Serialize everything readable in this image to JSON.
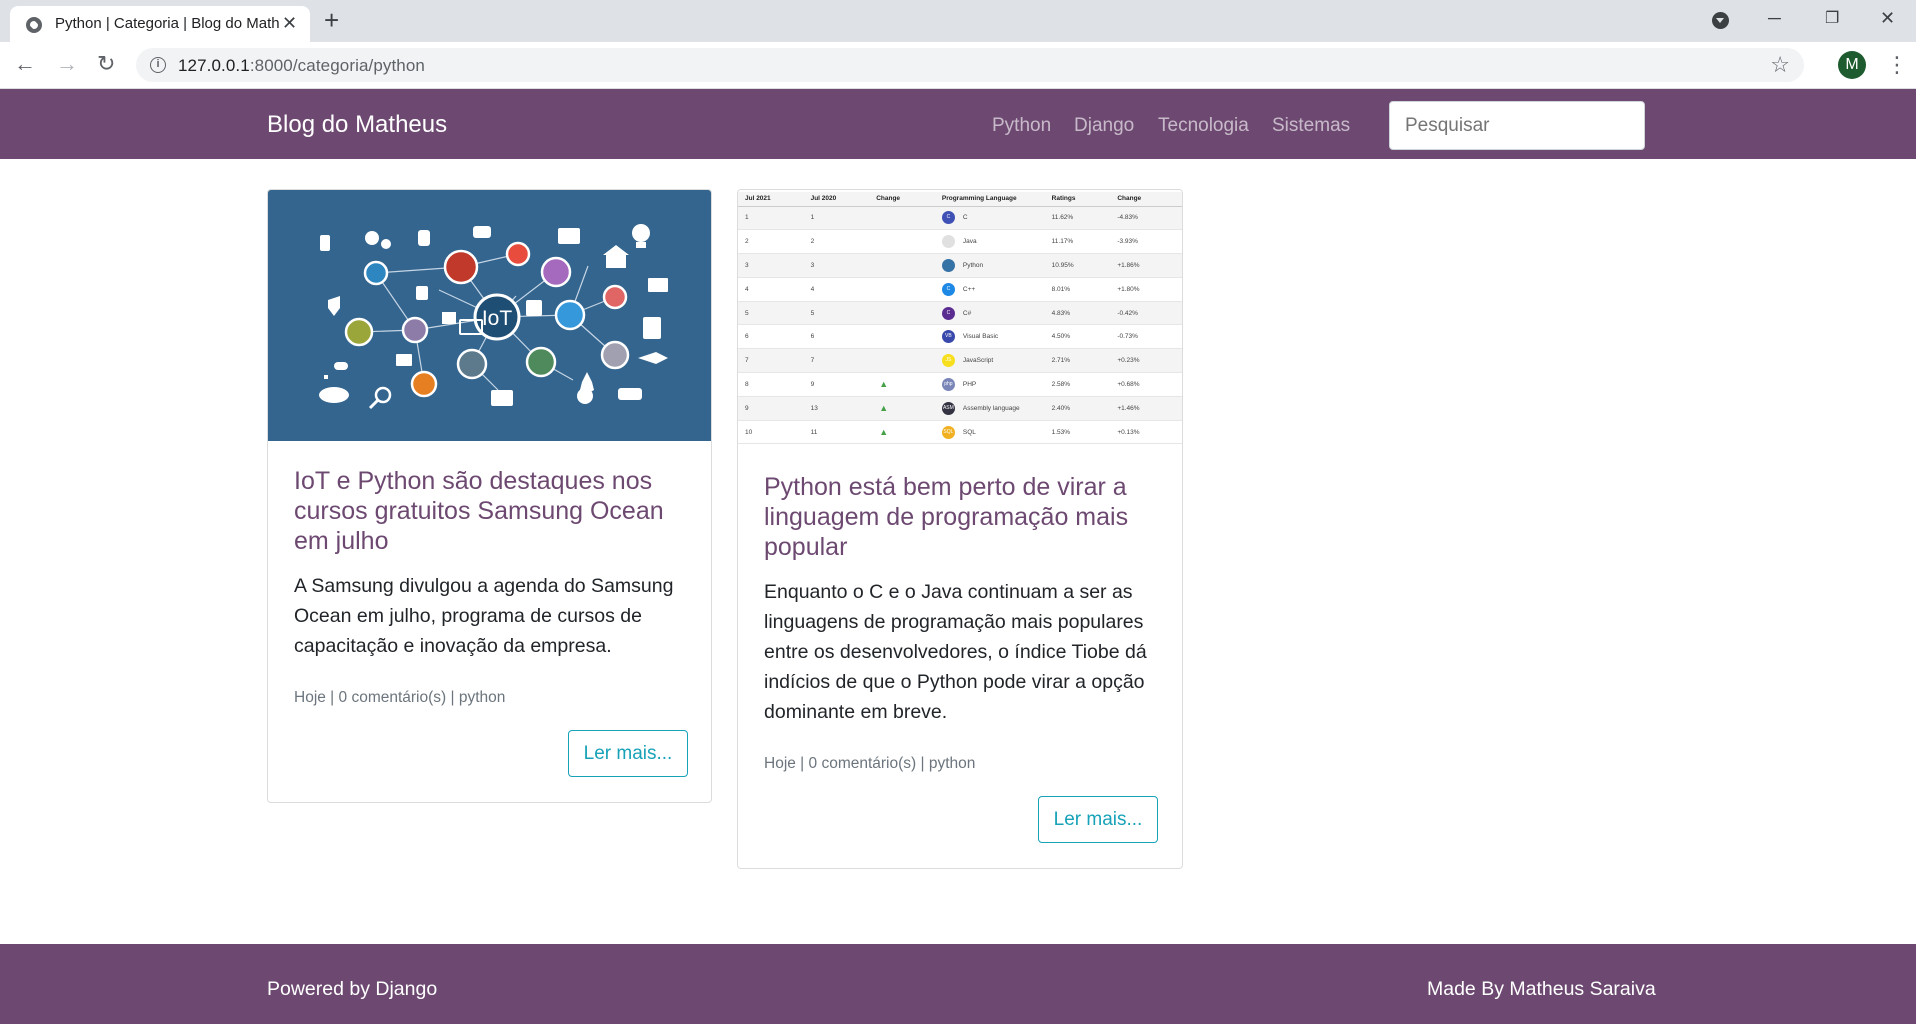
{
  "browser": {
    "tab_title": "Python | Categoria | Blog do Matheus",
    "url_host": "127.0.0.1",
    "url_path": ":8000/categoria/python",
    "avatar_letter": "M"
  },
  "navbar": {
    "brand": "Blog do Matheus",
    "links": [
      "Python",
      "Django",
      "Tecnologia",
      "Sistemas"
    ],
    "search_placeholder": "Pesquisar",
    "bg_color": "#6d4971"
  },
  "posts": [
    {
      "title": "IoT e Python são destaques nos cursos gratuitos Samsung Ocean em julho",
      "excerpt": "A Samsung divulgou a agenda do Samsung Ocean em julho, programa de cursos de capacitação e inovação da empresa.",
      "meta": "Hoje | 0 comentário(s) | python",
      "button": "Ler mais...",
      "image_label": "IoT"
    },
    {
      "title": "Python está bem perto de virar a linguagem de programação mais popular",
      "excerpt": "Enquanto o C e o Java continuam a ser as linguagens de programação mais populares entre os desenvolvedores, o índice Tiobe dá indícios de que o Python pode virar a opção dominante em breve.",
      "meta": "Hoje | 0 comentário(s) | python",
      "button": "Ler mais...",
      "table": {
        "headers": [
          "Jul 2021",
          "Jul 2020",
          "Change",
          "Programming Language",
          "Ratings",
          "Change"
        ],
        "rows": [
          [
            "1",
            "1",
            "",
            "C",
            "11.62%",
            "-4.83%"
          ],
          [
            "2",
            "2",
            "",
            "Java",
            "11.17%",
            "-3.93%"
          ],
          [
            "3",
            "3",
            "",
            "Python",
            "10.95%",
            "+1.86%"
          ],
          [
            "4",
            "4",
            "",
            "C++",
            "8.01%",
            "+1.80%"
          ],
          [
            "5",
            "5",
            "",
            "C#",
            "4.83%",
            "-0.42%"
          ],
          [
            "6",
            "6",
            "",
            "Visual Basic",
            "4.50%",
            "-0.73%"
          ],
          [
            "7",
            "7",
            "",
            "JavaScript",
            "2.71%",
            "+0.23%"
          ],
          [
            "8",
            "9",
            "^",
            "PHP",
            "2.58%",
            "+0.68%"
          ],
          [
            "9",
            "13",
            "^",
            "Assembly language",
            "2.40%",
            "+1.46%"
          ],
          [
            "10",
            "11",
            "^",
            "SQL",
            "1.53%",
            "+0.13%"
          ]
        ],
        "icon_colors": [
          "#3f51b5",
          "#e0e0e0",
          "#3572a5",
          "#1e88e5",
          "#5c2d91",
          "#3949ab",
          "#f7df1e",
          "#7a86b8",
          "#333344",
          "#f0b020"
        ],
        "icon_labels": [
          "C",
          "",
          "",
          "C",
          "C",
          "VB",
          "JS",
          "php",
          "ASM",
          "SQL"
        ]
      }
    }
  ],
  "footer": {
    "left": "Powered by Django",
    "right": "Made By Matheus Saraiva"
  }
}
